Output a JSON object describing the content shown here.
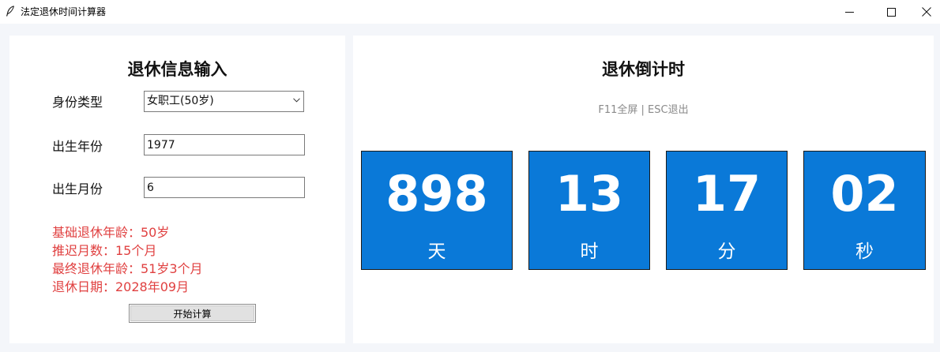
{
  "window": {
    "title": "法定退休时间计算器",
    "icon": "feather-icon",
    "controls": [
      "minimize-icon",
      "maximize-icon",
      "close-icon"
    ]
  },
  "left_panel": {
    "title": "退休信息输入",
    "identity_label": "身份类型",
    "identity_value": "女职工(50岁)",
    "birth_year_label": "出生年份",
    "birth_year_value": "1977",
    "birth_month_label": "出生月份",
    "birth_month_value": "6",
    "results": [
      "基础退休年龄：50岁",
      "推迟月数：15个月",
      "最终退休年龄：51岁3个月",
      "退休日期：2028年09月"
    ],
    "calculate_label": "开始计算"
  },
  "right_panel": {
    "title": "退休倒计时",
    "hint": "F11全屏 | ESC退出",
    "countdown": [
      {
        "value": "898",
        "unit": "天"
      },
      {
        "value": "13",
        "unit": "时"
      },
      {
        "value": "17",
        "unit": "分"
      },
      {
        "value": "02",
        "unit": "秒"
      }
    ]
  },
  "colors": {
    "background": "#f4f6fa",
    "panel": "#ffffff",
    "countdown_box": "#0a79d8",
    "result_text": "#e04040",
    "hint_text": "#8a8a8a"
  }
}
